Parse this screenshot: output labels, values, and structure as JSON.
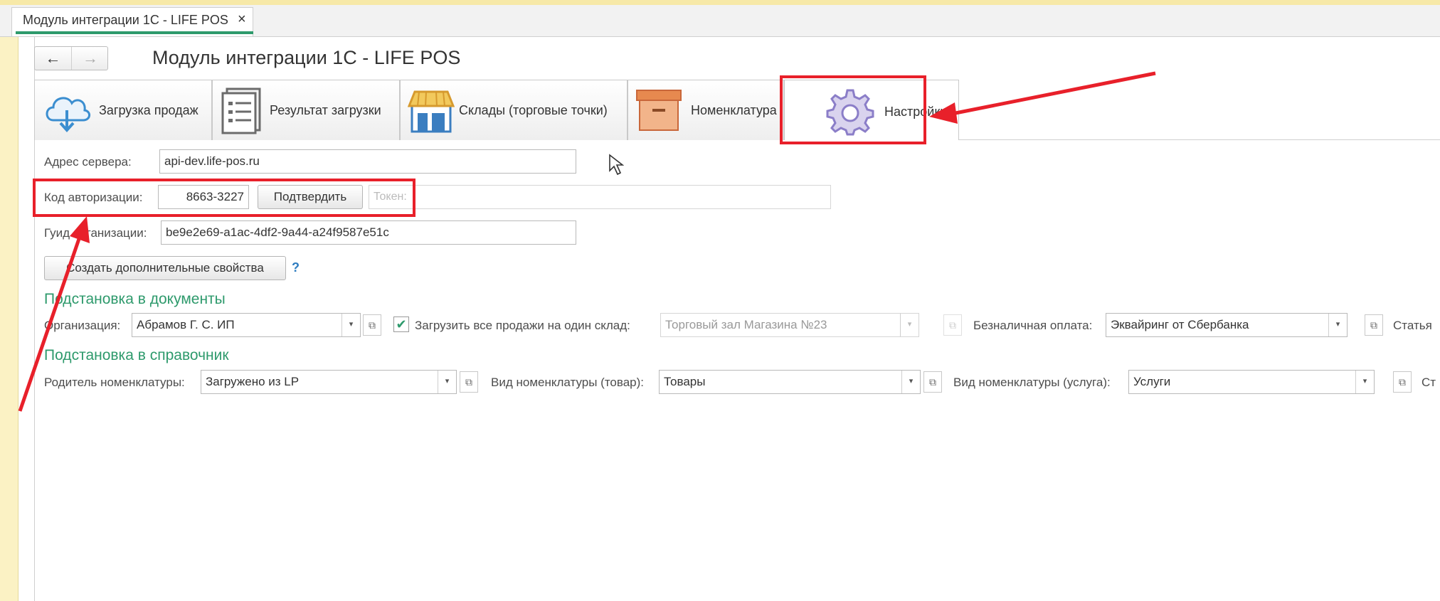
{
  "window_tab": {
    "title": "Модуль интеграции 1С - LIFE POS",
    "close": "×"
  },
  "nav": {
    "back": "←",
    "forward": "→"
  },
  "page_title": "Модуль интеграции 1С - LIFE POS",
  "tabs": [
    {
      "label": "Загрузка продаж",
      "icon": "cloud-download-icon"
    },
    {
      "label": "Результат загрузки",
      "icon": "list-document-icon"
    },
    {
      "label": "Склады (торговые точки)",
      "icon": "store-icon"
    },
    {
      "label": "Номенклатура",
      "icon": "box-icon"
    },
    {
      "label": "Настройки",
      "icon": "gear-icon",
      "active": true
    }
  ],
  "form": {
    "server_label": "Адрес сервера:",
    "server_value": "api-dev.life-pos.ru",
    "auth_label": "Код авторизации:",
    "auth_value": "8663-3227",
    "confirm_button": "Подтвердить",
    "token_placeholder": "Токен:",
    "guid_label": "Гуид организации:",
    "guid_value": "be9e2e69-a1ac-4df2-9a44-a24f9587e51c",
    "create_props_button": "Создать дополнительные свойства",
    "help": "?"
  },
  "docs_section": {
    "title": "Подстановка в документы",
    "org_label": "Организация:",
    "org_value": "Абрамов Г. С. ИП",
    "one_store_checkbox_label": "Загрузить все продажи на один склад:",
    "one_store_checked": true,
    "store_value": "Торговый зал Магазина №23",
    "cashless_label": "Безналичная оплата:",
    "cashless_value": "Эквайринг от Сбербанка",
    "article_label": "Статья"
  },
  "catalog_section": {
    "title": "Подстановка в справочник",
    "parent_label": "Родитель номенклатуры:",
    "parent_value": "Загружено из LP",
    "goods_kind_label": "Вид номенклатуры (товар):",
    "goods_kind_value": "Товары",
    "service_kind_label": "Вид номенклатуры (услуга):",
    "service_kind_value": "Услуги",
    "cut_label": "Ст"
  },
  "icons": {
    "dropdown": "▾",
    "open": "⧉",
    "checkmark": "✔"
  },
  "colors": {
    "accent_green": "#2e9a6c",
    "annotation_red": "#e8202a",
    "panel_yellow": "#fbf2c4"
  }
}
